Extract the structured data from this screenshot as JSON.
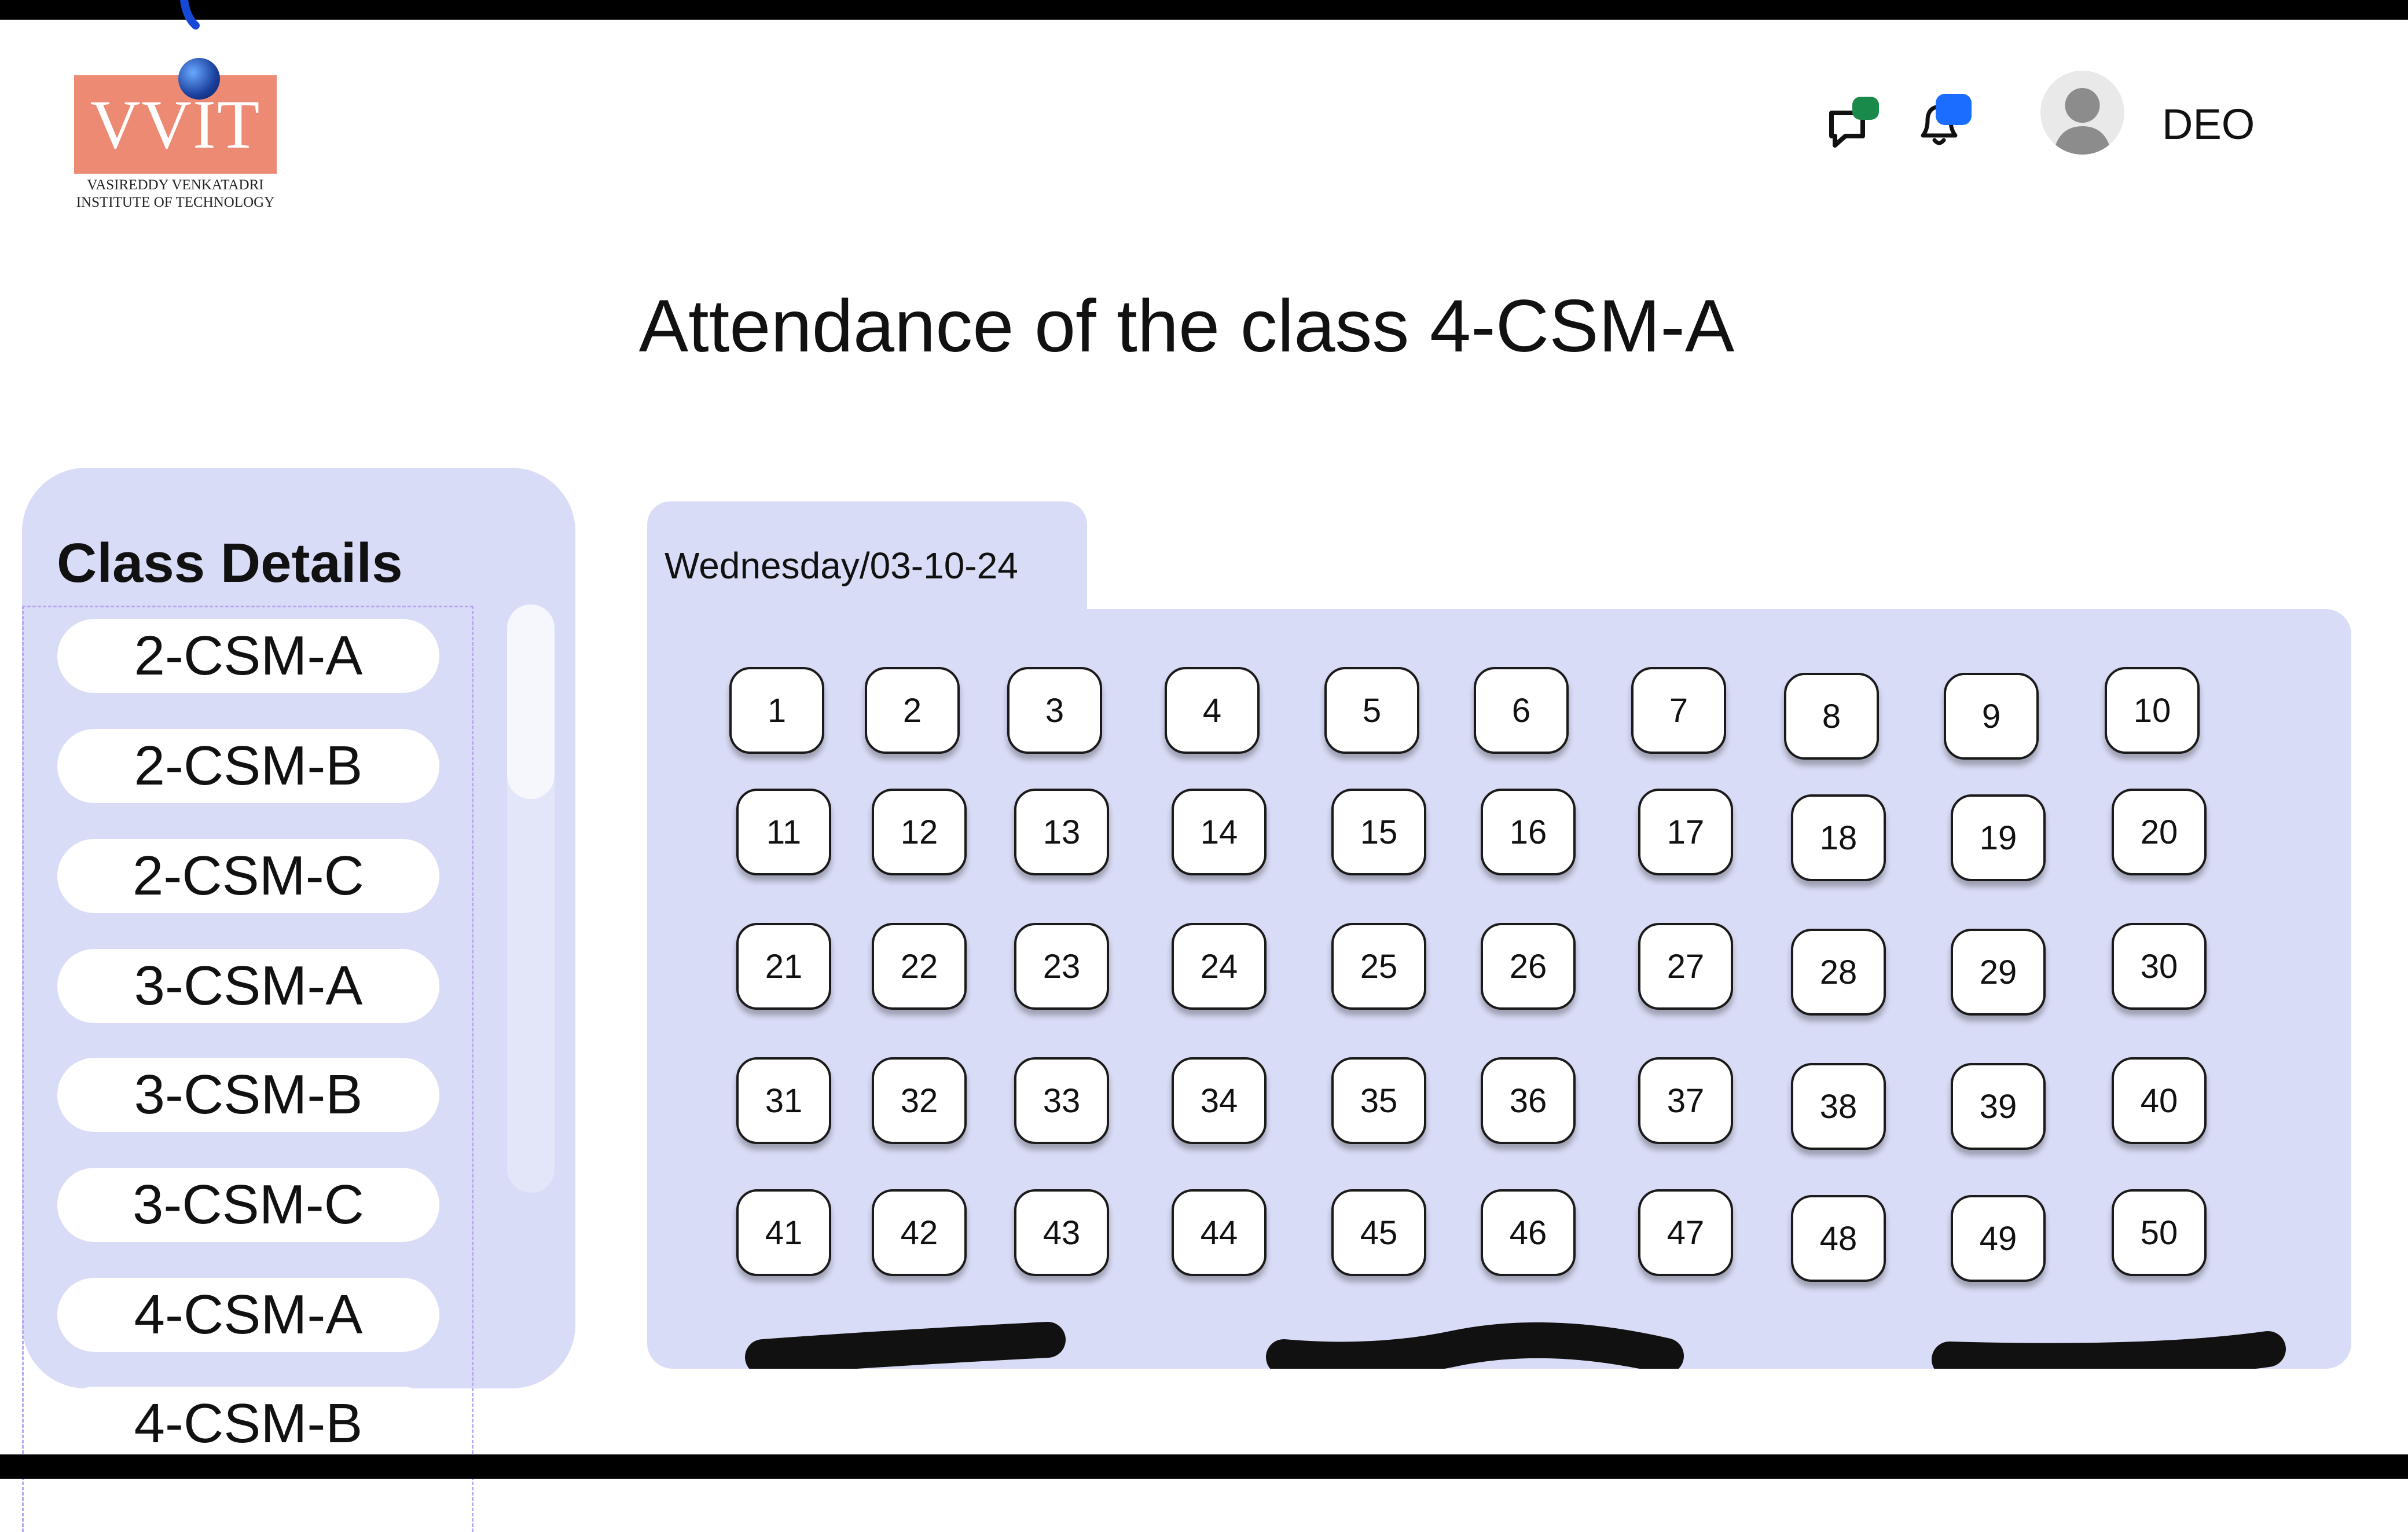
{
  "header": {
    "logo_text": "VVIT",
    "logo_subtitle_line1": "VASIREDDY VENKATADRI",
    "logo_subtitle_line2": "INSTITUTE OF TECHNOLOGY",
    "user_name": "DEO",
    "chat_badge_color": "#1a8a4a",
    "bell_badge_color": "#1a6dff",
    "icons": [
      "chat-icon",
      "bell-icon",
      "user-avatar-icon"
    ]
  },
  "page_title": "Attendance of the class 4-CSM-A",
  "sidebar": {
    "title": "Class Details",
    "items": [
      "2-CSM-A",
      "2-CSM-B",
      "2-CSM-C",
      "3-CSM-A",
      "3-CSM-B",
      "3-CSM-C",
      "4-CSM-A",
      "4-CSM-B"
    ]
  },
  "attendance": {
    "date_label": "Wednesday/03-10-24",
    "roll_numbers": [
      "1",
      "2",
      "3",
      "4",
      "5",
      "6",
      "7",
      "8",
      "9",
      "10",
      "11",
      "12",
      "13",
      "14",
      "15",
      "16",
      "17",
      "18",
      "19",
      "20",
      "21",
      "22",
      "23",
      "24",
      "25",
      "26",
      "27",
      "28",
      "29",
      "30",
      "31",
      "32",
      "33",
      "34",
      "35",
      "36",
      "37",
      "38",
      "39",
      "40",
      "41",
      "42",
      "43",
      "44",
      "45",
      "46",
      "47",
      "48",
      "49",
      "50"
    ]
  },
  "colors": {
    "panel_background": "#d9dcf6",
    "logo_background": "#ec8a73"
  }
}
